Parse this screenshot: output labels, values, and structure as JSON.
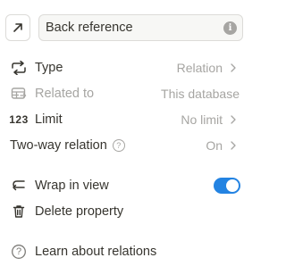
{
  "header": {
    "name_value": "Back reference",
    "icon": "arrow-up-right-icon",
    "info_icon": "info-icon",
    "info_glyph": "i"
  },
  "rows": {
    "type": {
      "label": "Type",
      "value": "Relation",
      "icon": "relation-type-icon"
    },
    "related_to": {
      "label": "Related to",
      "value": "This database",
      "icon": "database-icon"
    },
    "limit": {
      "label": "Limit",
      "value": "No limit",
      "icon_text": "123"
    },
    "two_way": {
      "label": "Two-way relation",
      "help_glyph": "?",
      "value": "On"
    },
    "wrap": {
      "label": "Wrap in view",
      "toggle_on": true,
      "icon": "wrap-arrow-icon"
    },
    "delete": {
      "label": "Delete property",
      "icon": "trash-icon"
    },
    "learn": {
      "label": "Learn about relations",
      "icon": "help-circle-icon",
      "glyph": "?"
    }
  },
  "colors": {
    "accent": "#2383e2",
    "text": "#37352f",
    "muted": "#a6a5a2"
  }
}
